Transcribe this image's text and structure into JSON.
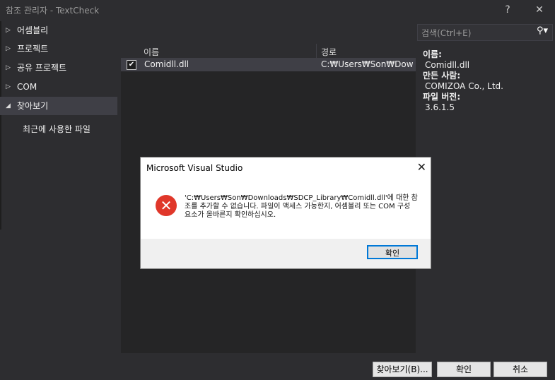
{
  "window": {
    "title": "참조 관리자 - TextCheck",
    "help": "?",
    "close": "✕"
  },
  "sidebar": {
    "items": [
      {
        "label": "어셈블리",
        "arrow": "▷"
      },
      {
        "label": "프로젝트",
        "arrow": "▷"
      },
      {
        "label": "공유 프로젝트",
        "arrow": "▷"
      },
      {
        "label": "COM",
        "arrow": "▷"
      },
      {
        "label": "찾아보기",
        "arrow": "◢"
      }
    ],
    "sub_item": "최근에 사용한 파일"
  },
  "list": {
    "headers": [
      "이름",
      "경로"
    ],
    "rows": [
      {
        "checked": true,
        "check_glyph": "✔",
        "name": "Comidll.dll",
        "path": "C:₩Users₩Son₩Down..."
      }
    ]
  },
  "search": {
    "placeholder": "검색(Ctrl+E)",
    "icon": "⚲▾"
  },
  "details": {
    "name_label": "이름:",
    "name_value": "Comidll.dll",
    "author_label": "만든 사람:",
    "author_value": "COMIZOA Co., Ltd.",
    "version_label": "파일 버전:",
    "version_value": "3.6.1.5"
  },
  "dialog": {
    "title": "Microsoft Visual Studio",
    "close": "✕",
    "error_glyph": "✕",
    "message": "'C:₩Users₩Son₩Downloads₩SDCP_Library₩Comidll.dll'에 대한 참조를 추가할 수 없습니다. 파일이 액세스 가능한지, 어셈블리 또는 COM 구성 요소가 올바른지 확인하십시오.",
    "ok": "확인"
  },
  "footer": {
    "browse": "찾아보기(B)...",
    "ok": "확인",
    "cancel": "취소"
  },
  "colors": {
    "background": "#2d2d30",
    "accent": "#0078d7",
    "error": "#e0372a"
  }
}
